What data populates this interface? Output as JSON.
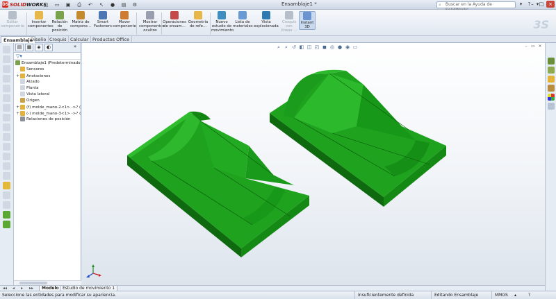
{
  "app": {
    "brand_prefix": "SOLID",
    "brand_suffix": "WORKS",
    "document_title": "Ensamblaje1 *"
  },
  "help_search": {
    "placeholder": "Buscar en la Ayuda de SolidWorks"
  },
  "command_manager": {
    "buttons": [
      {
        "label": "Editar\ncomponente",
        "icon": "edit-component-icon",
        "state": "disabled"
      },
      {
        "label": "Insertar\ncomponentes",
        "icon": "insert-components-icon",
        "state": "normal"
      },
      {
        "label": "Relación\nde\nposición",
        "icon": "mate-icon",
        "state": "normal"
      },
      {
        "label": "Matriz de\ncompone...",
        "icon": "component-pattern-icon",
        "state": "normal"
      },
      {
        "label": "Smart\nFasteners",
        "icon": "smart-fasteners-icon",
        "state": "normal"
      },
      {
        "label": "Mover\ncomponente",
        "icon": "move-component-icon",
        "state": "normal"
      },
      {
        "label": "Mostrar\ncomponentes\nocultos",
        "icon": "show-hidden-icon",
        "state": "normal"
      },
      {
        "label": "Operaciones\nde ensam...",
        "icon": "assembly-features-icon",
        "state": "normal"
      },
      {
        "label": "Geometría\nde refe...",
        "icon": "reference-geometry-icon",
        "state": "normal"
      },
      {
        "label": "Nuevo\nestudio de\nmovimiento",
        "icon": "motion-study-icon",
        "state": "normal"
      },
      {
        "label": "Lista de\nmateriales",
        "icon": "bom-icon",
        "state": "normal"
      },
      {
        "label": "Vista\nexplosionada",
        "icon": "exploded-view-icon",
        "state": "normal"
      },
      {
        "label": "Croquis\ncon\nlíneas ...",
        "icon": "explode-line-sketch-icon",
        "state": "disabled"
      },
      {
        "label": "Instant\n3D",
        "icon": "instant3d-icon",
        "state": "active"
      }
    ]
  },
  "tabs": [
    {
      "label": "Ensamblaje",
      "active": true
    },
    {
      "label": "Diseño",
      "active": false
    },
    {
      "label": "Croquis",
      "active": false
    },
    {
      "label": "Calcular",
      "active": false
    },
    {
      "label": "Productos Office",
      "active": false
    }
  ],
  "feature_tree": {
    "root": "Ensamblaje1  (Predeterminado",
    "items": [
      {
        "label": "Sensores",
        "icon": "sensors-icon",
        "expander": ""
      },
      {
        "label": "Anotaciones",
        "icon": "annotations-icon",
        "expander": "+"
      },
      {
        "label": "Alzado",
        "icon": "front-plane-icon",
        "expander": ""
      },
      {
        "label": "Planta",
        "icon": "top-plane-icon",
        "expander": ""
      },
      {
        "label": "Vista lateral",
        "icon": "right-plane-icon",
        "expander": ""
      },
      {
        "label": "Origen",
        "icon": "origin-icon",
        "expander": ""
      },
      {
        "label": "(f) molde_mano-2<1> ->? (",
        "icon": "part-icon",
        "expander": "+"
      },
      {
        "label": "(-) molde_mano-3<1> ->? (",
        "icon": "part-icon",
        "expander": "+"
      },
      {
        "label": "Relaciones de posición",
        "icon": "mates-folder-icon",
        "expander": ""
      }
    ]
  },
  "model_tabs": [
    {
      "label": "Modelo",
      "active": true
    },
    {
      "label": "Estudio de movimiento 1",
      "active": false
    }
  ],
  "status_bar": {
    "message": "Seleccione las entidades para modificar su apariencia.",
    "definition": "Insuficientemente definida",
    "mode": "Editando Ensamblaje",
    "units": "MMGS"
  },
  "colors": {
    "part_green": "#1fa31f",
    "part_dark": "#0f6a0f",
    "accent_blue": "#2b5fa8"
  }
}
